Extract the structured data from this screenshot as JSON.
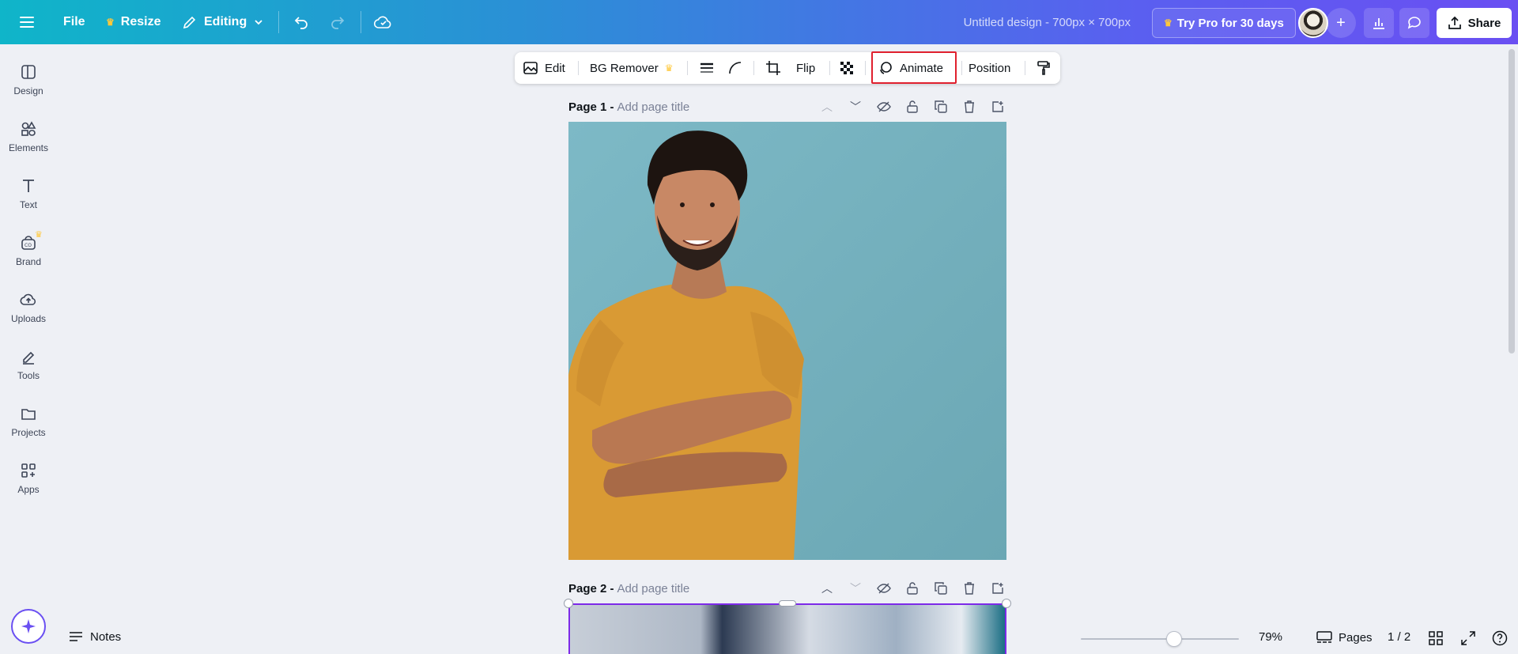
{
  "topbar": {
    "file": "File",
    "resize": "Resize",
    "editing": "Editing",
    "title": "Untitled design - 700px × 700px",
    "try_pro": "Try Pro for 30 days",
    "share": "Share"
  },
  "rail": {
    "items": [
      {
        "label": "Design",
        "icon": "layout-icon"
      },
      {
        "label": "Elements",
        "icon": "shapes-icon"
      },
      {
        "label": "Text",
        "icon": "text-icon"
      },
      {
        "label": "Brand",
        "icon": "brand-icon"
      },
      {
        "label": "Uploads",
        "icon": "cloud-upload-icon"
      },
      {
        "label": "Tools",
        "icon": "pen-icon"
      },
      {
        "label": "Projects",
        "icon": "folder-icon"
      },
      {
        "label": "Apps",
        "icon": "apps-icon"
      }
    ]
  },
  "toolbar": {
    "edit": "Edit",
    "bg_remover": "BG Remover",
    "flip": "Flip",
    "animate": "Animate",
    "position": "Position"
  },
  "pages": [
    {
      "label": "Page 1 -",
      "placeholder": "Add page title"
    },
    {
      "label": "Page 2 -",
      "placeholder": "Add page title"
    }
  ],
  "bottom": {
    "notes": "Notes",
    "zoom": "79%",
    "zoom_level": 0.59,
    "pages": "Pages",
    "page_count": "1 / 2"
  },
  "colors": {
    "accent": "#7d2ae8",
    "highlight": "#e0202e",
    "pro_crown": "#ffc83a"
  }
}
